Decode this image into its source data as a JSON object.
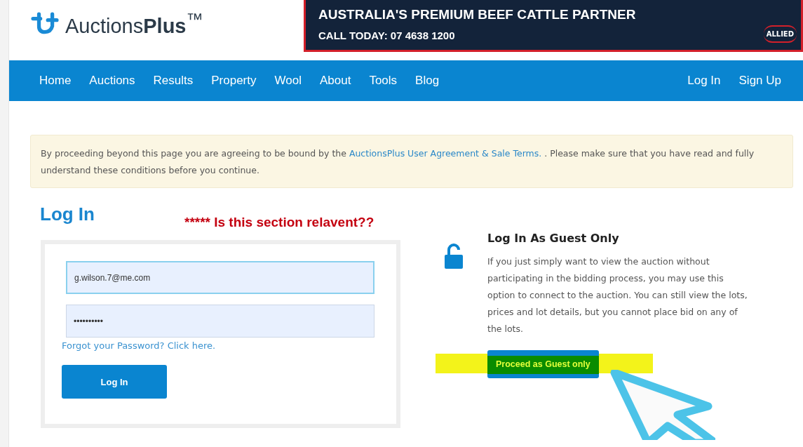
{
  "logo": {
    "text": "Auctions**Plus**$^{™}$"
  },
  "banner": {
    "headline": "AUSTRALIA'S PREMIUM BEEF CATTLE PARTNER",
    "phone": "CALL TODAY: 07 4638 1200",
    "brand": "ALLIED"
  },
  "nav": {
    "left": [
      "Home",
      "Auctions",
      "Results",
      "Property",
      "Wool",
      "About",
      "Tools",
      "Blog"
    ],
    "right": [
      "Log In",
      "Sign Up"
    ]
  },
  "notice": {
    "before": "By proceeding beyond this page you are agreeing to be bound by the ",
    "link": "AuctionsPlus User Agreement & Sale Terms.",
    "after": " . Please make sure that you have read and fully understand these conditions before you continue."
  },
  "login": {
    "title": "Log In",
    "annotation": "***** Is this section relavent??",
    "email": "g.wilson.7@me.com",
    "password": "••••••••••",
    "forgot": "Forgot your Password? Click here.",
    "button": "Log In"
  },
  "guest": {
    "title": "Log In As Guest Only",
    "text": "If you just simply want to view the auction without participating in the bidding process, you may use this option to connect to the auction. You can still view the lots, prices and lot details, but you cannot place bid on any of the lots.",
    "button": "Proceed as Guest only",
    "highlighted": true
  }
}
